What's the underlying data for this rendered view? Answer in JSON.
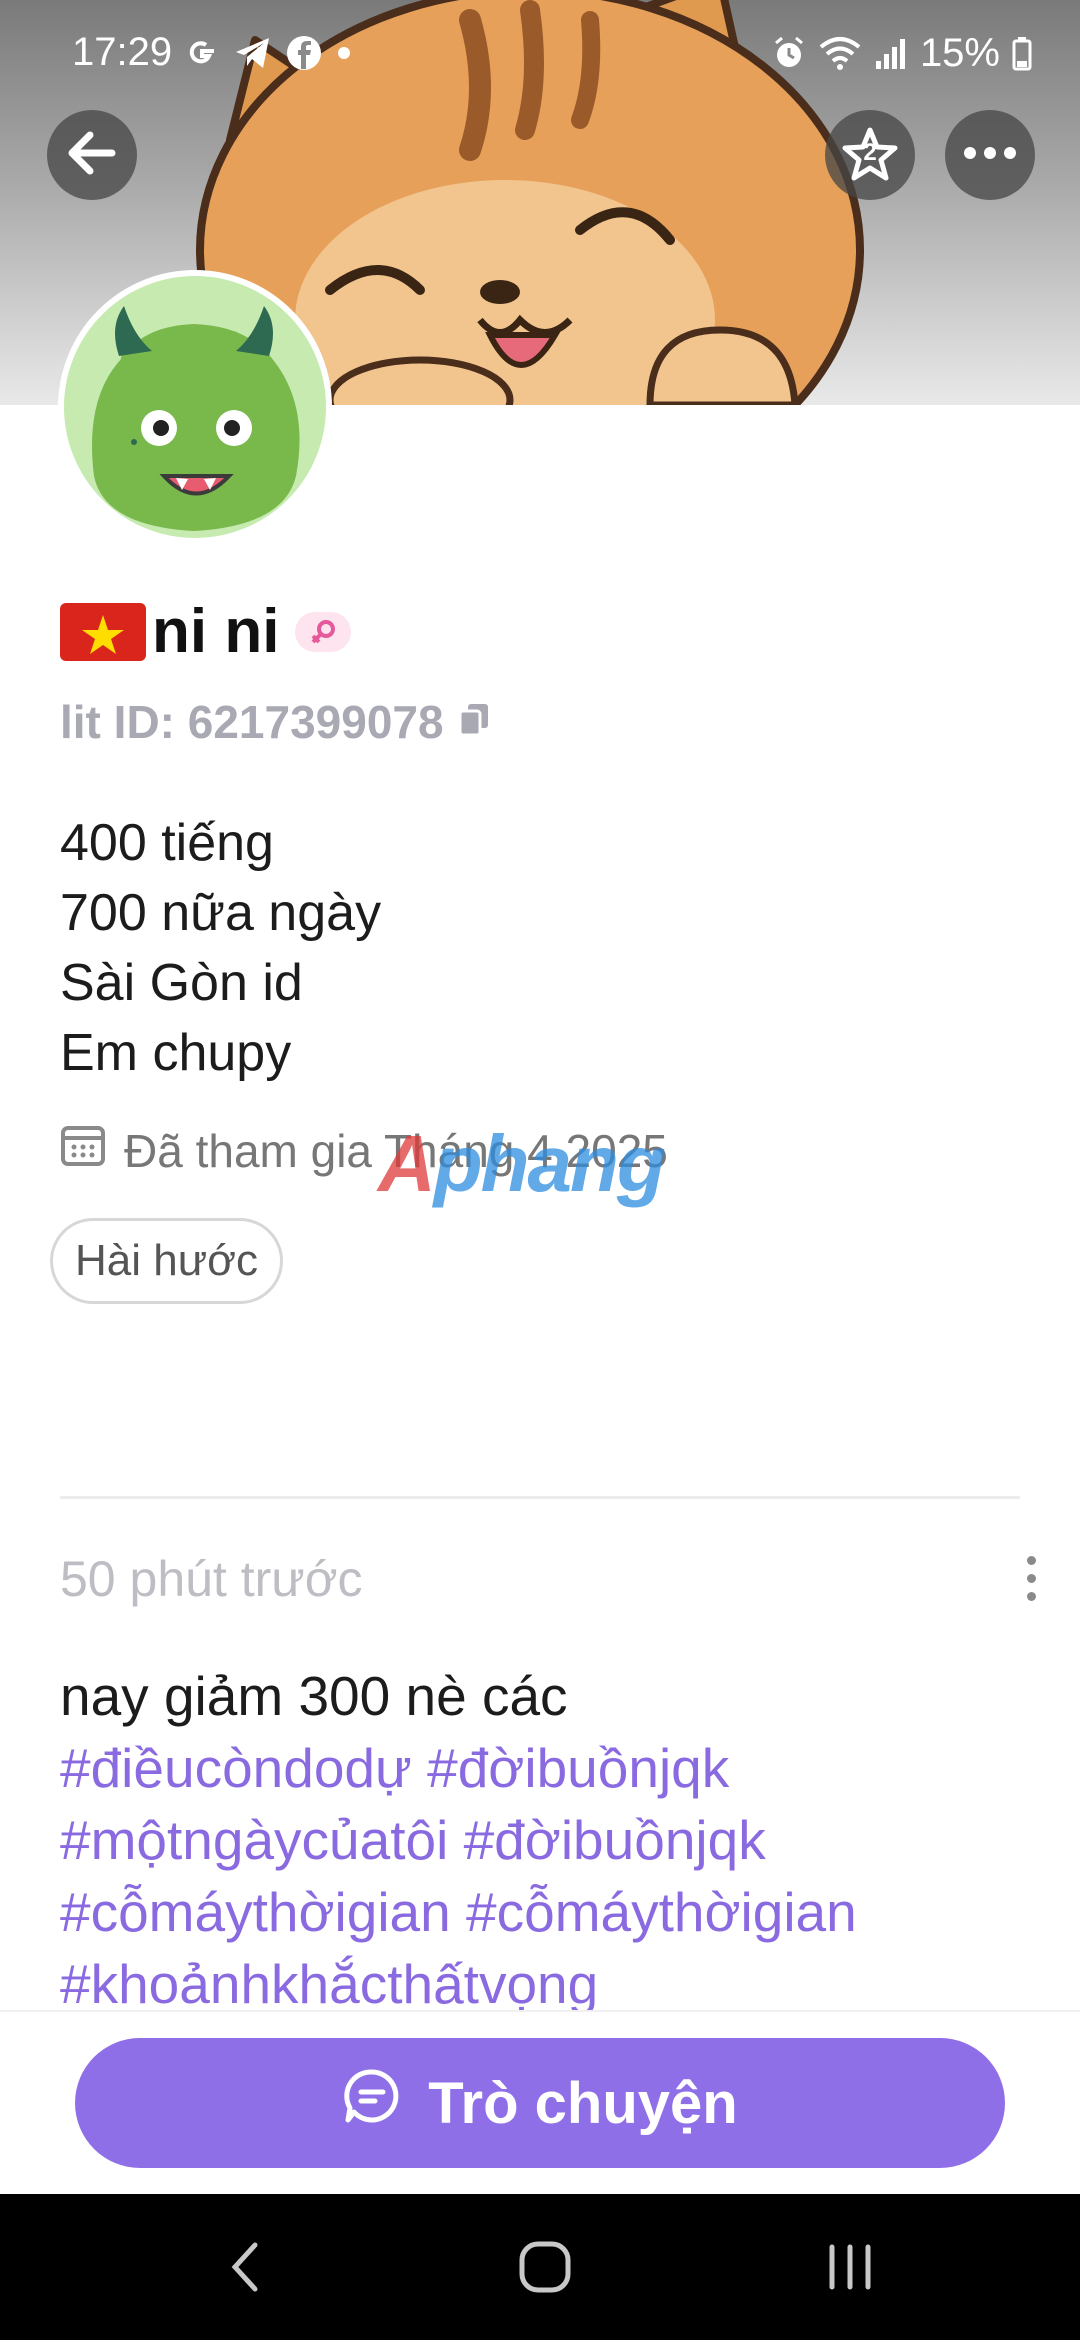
{
  "status_bar": {
    "time": "17:29",
    "battery": "15%",
    "icons": [
      "google-icon",
      "telegram-icon",
      "facebook-icon",
      "dot-icon",
      "alarm-icon",
      "wifi-icon",
      "signal-icon",
      "battery-icon"
    ]
  },
  "header": {
    "back_icon": "arrow-left-icon",
    "favorite_badge": "2",
    "more_icon": "more-horizontal-icon"
  },
  "profile": {
    "flag": "🇻🇳",
    "name": "ni ni",
    "gender_icon": "female-icon",
    "lit_id": "lit ID: 6217399078",
    "bio_lines": [
      "400 tiếng",
      "700 nữa ngày",
      "Sài Gòn id",
      "Em chupy"
    ],
    "joined": "Đã tham gia Tháng 4 2025",
    "tag": "Hài hước"
  },
  "watermark": {
    "part1": "A",
    "part2": "phang"
  },
  "post": {
    "time": "50 phút trước",
    "text": "nay giảm 300 nè các",
    "hashtags": [
      "#điềucòndodự",
      "#đờibuồnjqk",
      "#mộtngàycủatôi",
      "#đờibuồnjqk",
      "#cỗmáythờigian",
      "#cỗmáythờigian",
      "#khoảnhkhắcthấtvọng"
    ]
  },
  "actions": {
    "chat_label": "Trò chuyện"
  },
  "colors": {
    "accent": "#8f6fe8",
    "hashtag": "#8a6ae0",
    "id_gray": "#a9a9b4"
  }
}
